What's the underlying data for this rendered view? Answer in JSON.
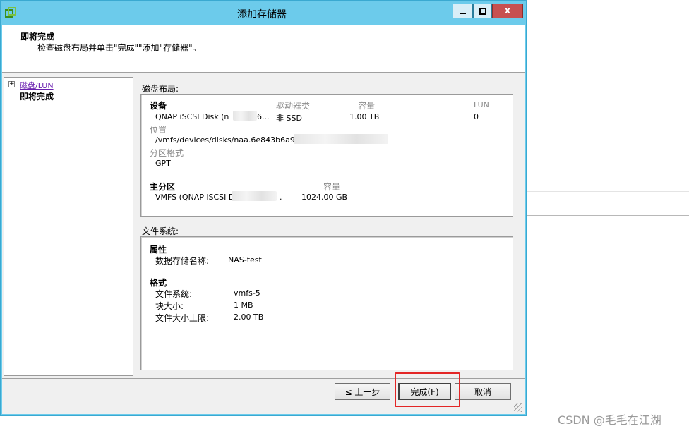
{
  "window": {
    "title": "添加存储器",
    "close_glyph": "x"
  },
  "header": {
    "title": "即将完成",
    "subtitle": "检查磁盘布局并单击\"完成\"\"添加\"存储器\"。"
  },
  "nav": {
    "items": [
      {
        "label": "磁盘/LUN",
        "visited": true
      },
      {
        "label": "即将完成",
        "current": true
      }
    ]
  },
  "disk_layout": {
    "section_label": "磁盘布局:",
    "col_device": "设备",
    "col_drive_type": "驱动器类",
    "col_capacity": "容量",
    "col_lun": "LUN",
    "device_name": "QNAP iSCSI Disk (n",
    "device_name_tail": "6...",
    "drive_type": "非 SSD",
    "capacity": "1.00 TB",
    "lun": "0",
    "location_label": "位置",
    "location_value": "/vmfs/devices/disks/naa.6e843b6a939",
    "partition_format_label": "分区格式",
    "partition_format_value": "GPT",
    "primary_partition_label": "主分区",
    "primary_capacity_label": "容量",
    "primary_partition_value": "VMFS (QNAP iSCSI Di",
    "primary_partition_tail": ".",
    "primary_capacity": "1024.00 GB"
  },
  "filesystem": {
    "section_label": "文件系统:",
    "properties_label": "属性",
    "datastore_name_label": "数据存储名称:",
    "datastore_name": "NAS-test",
    "format_label": "格式",
    "fs_label": "文件系统:",
    "fs_value": "vmfs-5",
    "block_size_label": "块大小:",
    "block_size_value": "1 MB",
    "max_file_label": "文件大小上限:",
    "max_file_value": "2.00 TB"
  },
  "buttons": {
    "back": "≤ 上一步",
    "finish": "完成(F)",
    "cancel": "取消"
  },
  "watermark": "CSDN @毛毛在江湖",
  "colors": {
    "titlebar": "#6ccbeb",
    "close": "#c75050",
    "link": "#6a1fb0",
    "highlight": "#e32626"
  }
}
